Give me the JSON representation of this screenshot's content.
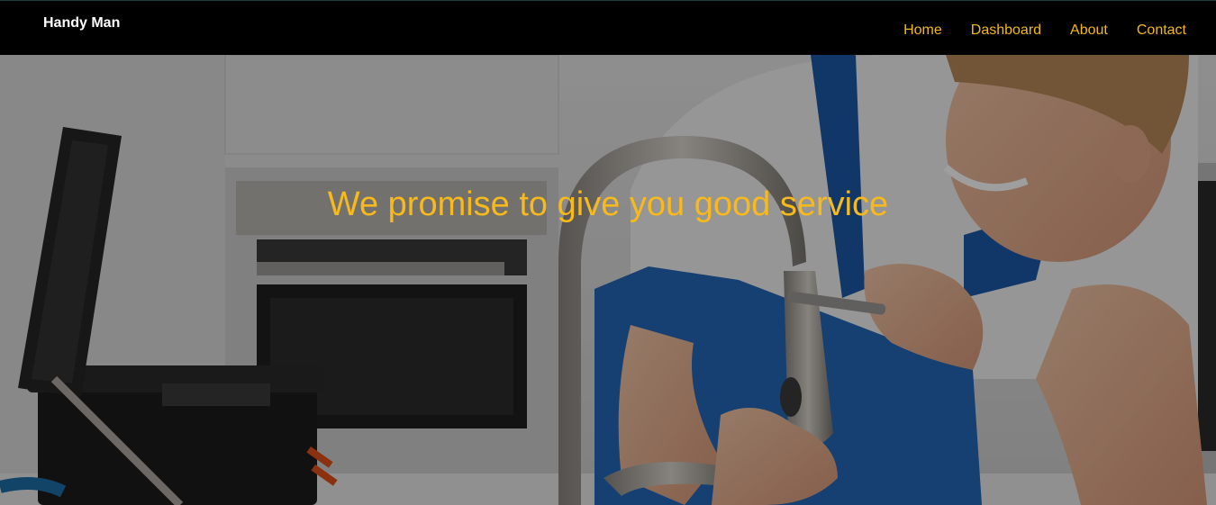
{
  "navbar": {
    "brand": "Handy Man",
    "links": [
      "Home",
      "Dashboard",
      "About",
      "Contact"
    ]
  },
  "hero": {
    "heading": "We promise to give you good service",
    "image": "plumber-fixing-faucet-photo"
  },
  "colors": {
    "accent": "#f7b91b",
    "navbar_bg": "#000000",
    "brand_text": "#ffffff"
  }
}
